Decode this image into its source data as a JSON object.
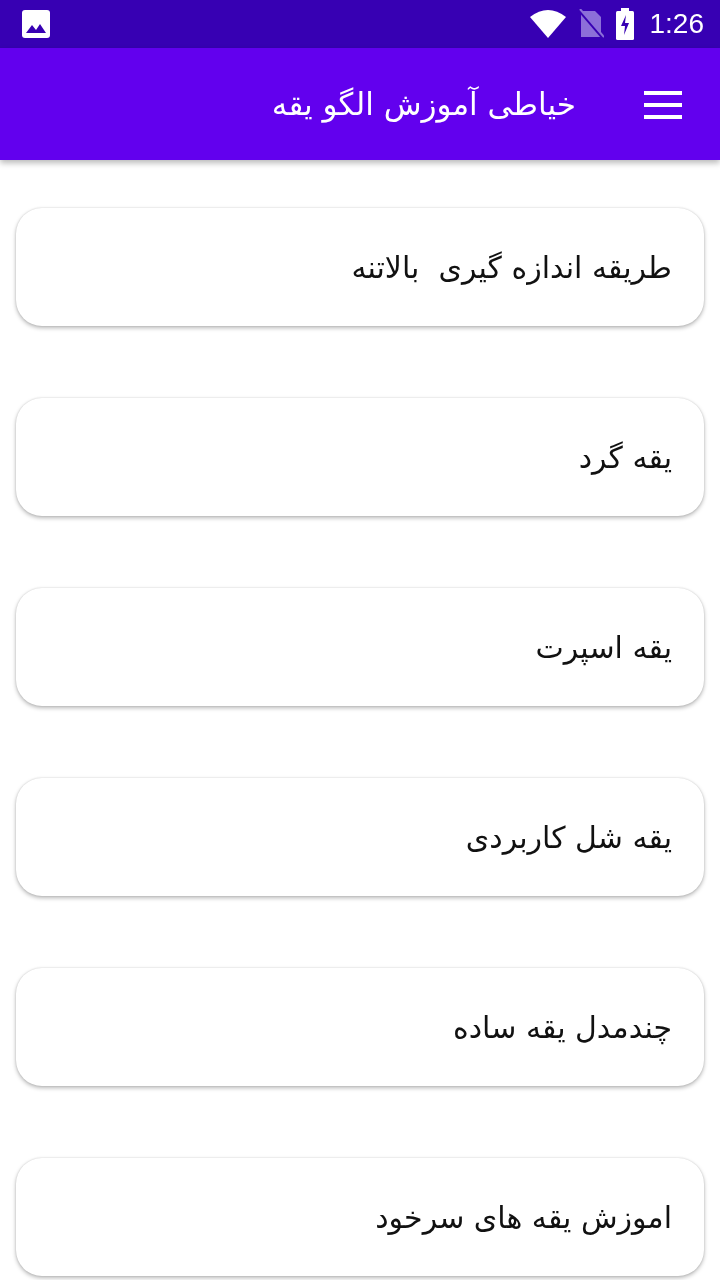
{
  "status_bar": {
    "time": "1:26"
  },
  "toolbar": {
    "title": "خیاطی آموزش الگو یقه"
  },
  "items": [
    {
      "label": "طریقه اندازه گیری  بالاتنه"
    },
    {
      "label": "یقه گرد"
    },
    {
      "label": "یقه اسپرت"
    },
    {
      "label": "یقه شل کاربردی"
    },
    {
      "label": "چندمدل یقه ساده"
    },
    {
      "label": "اموزش یقه های سرخود"
    }
  ]
}
